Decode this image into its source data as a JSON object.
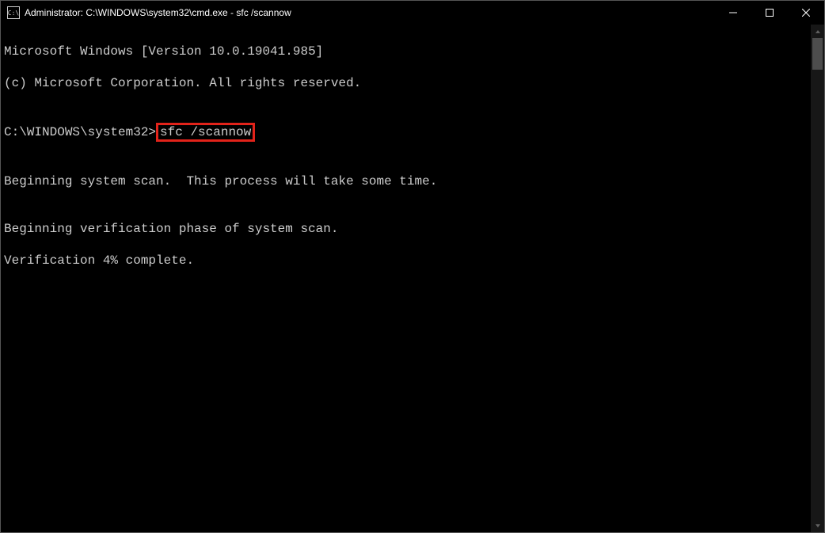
{
  "window": {
    "icon_text": "C:\\",
    "title": "Administrator: C:\\WINDOWS\\system32\\cmd.exe - sfc  /scannow"
  },
  "terminal": {
    "line_version": "Microsoft Windows [Version 10.0.19041.985]",
    "line_copyright": "(c) Microsoft Corporation. All rights reserved.",
    "blank": "",
    "prompt_prefix": "C:\\WINDOWS\\system32>",
    "command": "sfc /scannow",
    "line_begin_scan": "Beginning system scan.  This process will take some time.",
    "line_begin_verify": "Beginning verification phase of system scan.",
    "line_verify_progress": "Verification 4% complete."
  },
  "highlight": {
    "color": "#e2231a"
  }
}
